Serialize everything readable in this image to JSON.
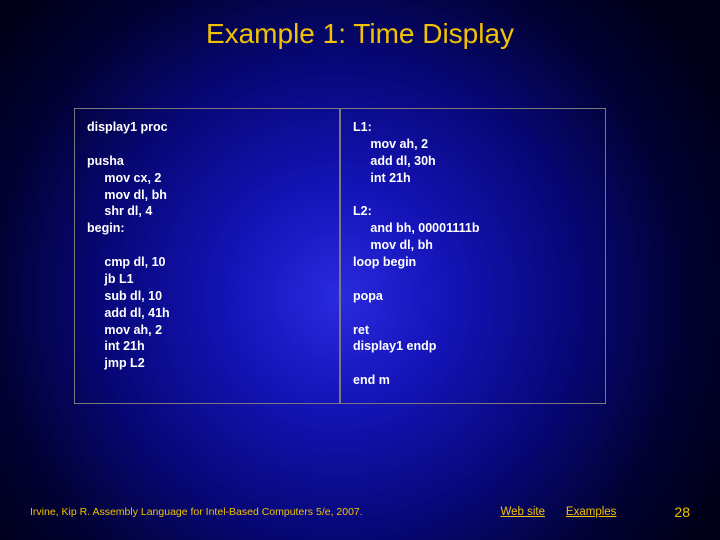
{
  "title": "Example 1: Time Display",
  "codeLeft": "display1 proc\n\npusha\n     mov cx, 2\n     mov dl, bh\n     shr dl, 4\nbegin:\n\n     cmp dl, 10\n     jb L1\n     sub dl, 10\n     add dl, 41h\n     mov ah, 2\n     int 21h\n     jmp L2",
  "codeRight": "L1:\n     mov ah, 2\n     add dl, 30h\n     int 21h\n\nL2:\n     and bh, 00001111b\n     mov dl, bh\nloop begin\n\npopa\n\nret\ndisplay1 endp\n\nend m",
  "footer": {
    "author": "Irvine, Kip R. Assembly Language for Intel-Based Computers 5/e, 2007.",
    "link1": "Web site",
    "link2": "Examples",
    "page": "28"
  }
}
